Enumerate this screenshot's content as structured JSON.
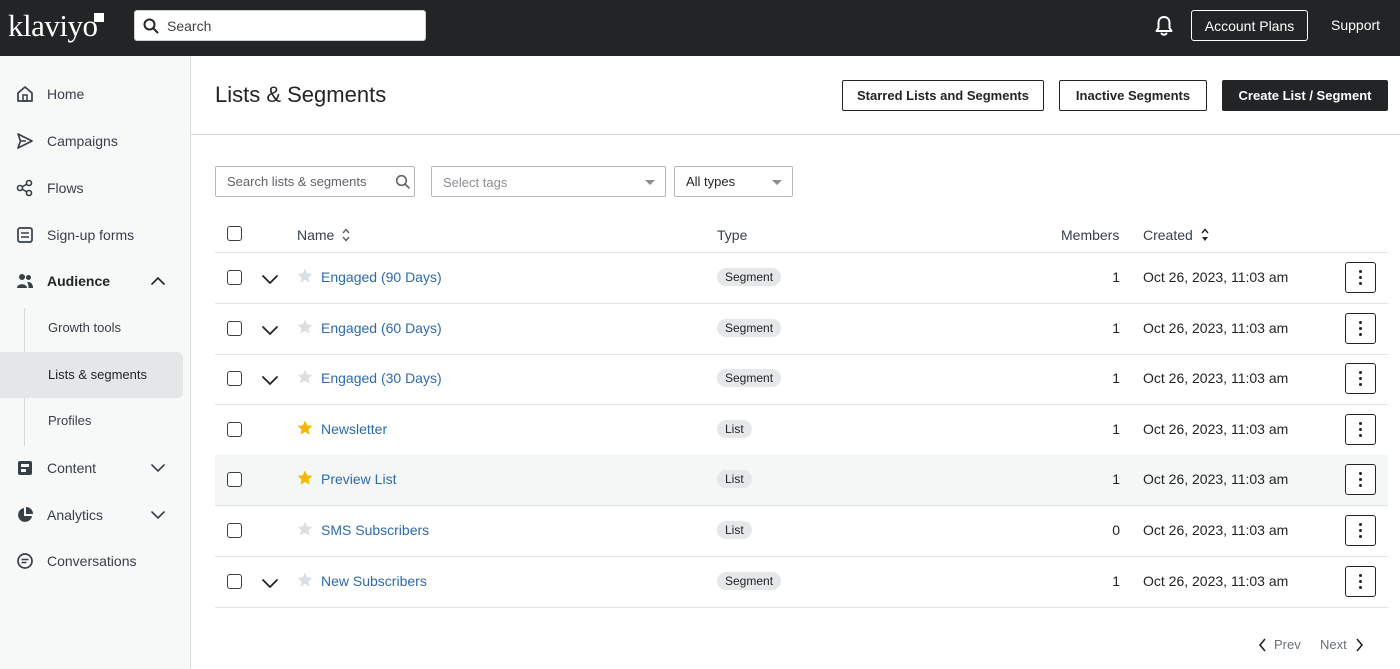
{
  "topbar": {
    "logo": "klaviyo",
    "search_placeholder": "Search",
    "account_plans": "Account Plans",
    "support": "Support"
  },
  "sidebar": {
    "items": [
      {
        "label": "Home",
        "icon": "home-icon"
      },
      {
        "label": "Campaigns",
        "icon": "send-icon"
      },
      {
        "label": "Flows",
        "icon": "flows-icon"
      },
      {
        "label": "Sign-up forms",
        "icon": "form-icon"
      },
      {
        "label": "Audience",
        "icon": "audience-icon"
      },
      {
        "label": "Content",
        "icon": "content-icon"
      },
      {
        "label": "Analytics",
        "icon": "analytics-icon"
      },
      {
        "label": "Conversations",
        "icon": "chat-icon"
      }
    ],
    "audience_sub": [
      {
        "label": "Growth tools"
      },
      {
        "label": "Lists & segments"
      },
      {
        "label": "Profiles"
      }
    ]
  },
  "main": {
    "title": "Lists & Segments",
    "buttons": {
      "starred": "Starred Lists and Segments",
      "inactive": "Inactive Segments",
      "create": "Create List / Segment"
    },
    "filters": {
      "search_placeholder": "Search lists & segments",
      "tags_placeholder": "Select tags",
      "type_value": "All types"
    },
    "columns": {
      "name": "Name",
      "type": "Type",
      "members": "Members",
      "created": "Created"
    },
    "rows": [
      {
        "name": "Engaged (90 Days)",
        "type": "Segment",
        "members": "1",
        "created": "Oct 26, 2023, 11:03 am",
        "starred": false,
        "expandable": true
      },
      {
        "name": "Engaged (60 Days)",
        "type": "Segment",
        "members": "1",
        "created": "Oct 26, 2023, 11:03 am",
        "starred": false,
        "expandable": true
      },
      {
        "name": "Engaged (30 Days)",
        "type": "Segment",
        "members": "1",
        "created": "Oct 26, 2023, 11:03 am",
        "starred": false,
        "expandable": true
      },
      {
        "name": "Newsletter",
        "type": "List",
        "members": "1",
        "created": "Oct 26, 2023, 11:03 am",
        "starred": true,
        "expandable": false
      },
      {
        "name": "Preview List",
        "type": "List",
        "members": "1",
        "created": "Oct 26, 2023, 11:03 am",
        "starred": true,
        "expandable": false
      },
      {
        "name": "SMS Subscribers",
        "type": "List",
        "members": "0",
        "created": "Oct 26, 2023, 11:03 am",
        "starred": false,
        "expandable": false
      },
      {
        "name": "New Subscribers",
        "type": "Segment",
        "members": "1",
        "created": "Oct 26, 2023, 11:03 am",
        "starred": false,
        "expandable": true
      }
    ],
    "pagination": {
      "prev": "Prev",
      "next": "Next"
    }
  },
  "colors": {
    "topbar": "#232426",
    "link": "#2d6bab",
    "star_active": "#f5b800",
    "star_inactive": "#dcdfe2"
  }
}
